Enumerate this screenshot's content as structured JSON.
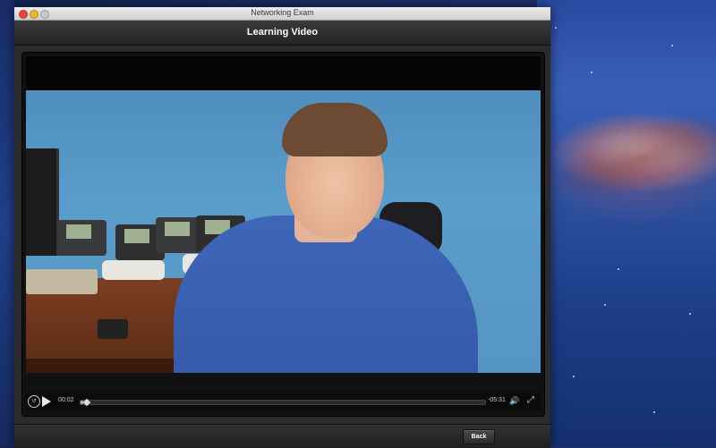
{
  "window": {
    "title": "Networking Exam"
  },
  "header": {
    "title": "Learning Video"
  },
  "player": {
    "elapsed": "00:02",
    "remaining": "-05:31",
    "progress": 0.006,
    "replay_icon": "replay-icon",
    "play_icon": "play-icon",
    "volume_icon": "speaker-icon",
    "fullscreen_icon": "fullscreen-icon"
  },
  "footer": {
    "back_label": "Back"
  },
  "colors": {
    "traffic_close": "#e2463f",
    "traffic_min": "#e8b53a",
    "window_bg": "#2b2b2d"
  }
}
